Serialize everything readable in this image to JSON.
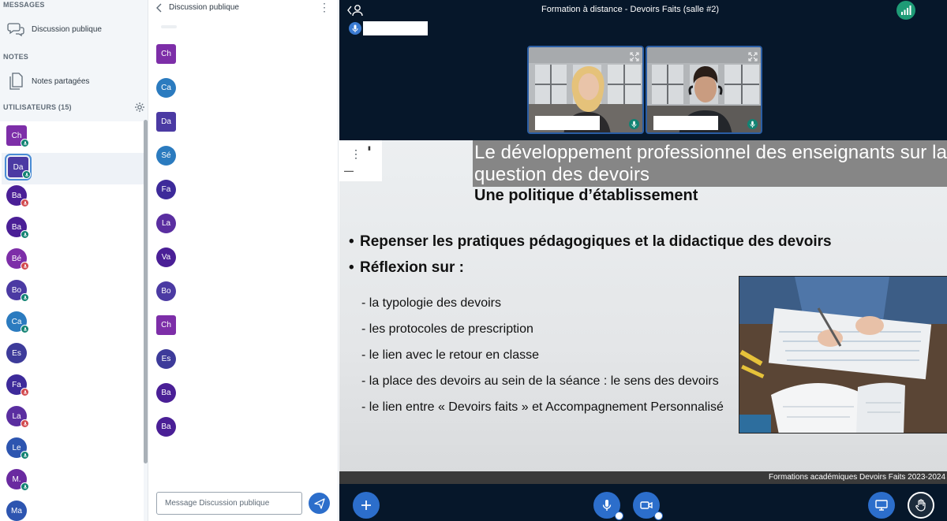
{
  "sidebar": {
    "messages_title": "MESSAGES",
    "public_chat_label": "Discussion publique",
    "notes_title": "NOTES",
    "shared_notes_label": "Notes partagées",
    "users_title": "UTILISATEURS (15)",
    "users": [
      {
        "initials": "Ch",
        "color": "#7d2ea8",
        "shape": "sq",
        "status": "on"
      },
      {
        "initials": "Da",
        "color": "#4b3aa3",
        "shape": "sq",
        "status": "on",
        "presenter": true
      },
      {
        "initials": "Ba",
        "color": "#4a1f96",
        "shape": "rd",
        "status": "off"
      },
      {
        "initials": "Ba",
        "color": "#4a1f96",
        "shape": "rd",
        "status": "on"
      },
      {
        "initials": "Bé",
        "color": "#7d2ea8",
        "shape": "rd",
        "status": "off"
      },
      {
        "initials": "Bo",
        "color": "#4b3aa3",
        "shape": "rd",
        "status": "on"
      },
      {
        "initials": "Ca",
        "color": "#2b7bbf",
        "shape": "rd",
        "status": "on"
      },
      {
        "initials": "Es",
        "color": "#3d3b9a",
        "shape": "rd",
        "status": "none"
      },
      {
        "initials": "Fa",
        "color": "#3d2a9a",
        "shape": "rd",
        "status": "off"
      },
      {
        "initials": "La",
        "color": "#5a2ea0",
        "shape": "rd",
        "status": "off"
      },
      {
        "initials": "Le",
        "color": "#2d55b0",
        "shape": "rd",
        "status": "on"
      },
      {
        "initials": "M.",
        "color": "#6a2aa0",
        "shape": "rd",
        "status": "on"
      },
      {
        "initials": "Ma",
        "color": "#2d55b0",
        "shape": "rd",
        "status": "none"
      }
    ]
  },
  "chat": {
    "title": "Discussion publique",
    "input_placeholder": "Message Discussion publique",
    "messages": [
      {
        "initials": "Ch",
        "color": "#7d2ea8",
        "shape": "sq"
      },
      {
        "initials": "Ca",
        "color": "#2b7bbf",
        "shape": "rd"
      },
      {
        "initials": "Da",
        "color": "#4b3aa3",
        "shape": "sq"
      },
      {
        "initials": "Sé",
        "color": "#2b7bbf",
        "shape": "rd"
      },
      {
        "initials": "Fa",
        "color": "#3d2a9a",
        "shape": "rd"
      },
      {
        "initials": "La",
        "color": "#5a2ea0",
        "shape": "rd"
      },
      {
        "initials": "Va",
        "color": "#4a1f96",
        "shape": "rd"
      },
      {
        "initials": "Bo",
        "color": "#4b3aa3",
        "shape": "rd"
      },
      {
        "initials": "Ch",
        "color": "#7d2ea8",
        "shape": "sq"
      },
      {
        "initials": "Es",
        "color": "#3d3b9a",
        "shape": "rd"
      },
      {
        "initials": "Ba",
        "color": "#4a1f96",
        "shape": "rd"
      },
      {
        "initials": "Ba",
        "color": "#4a1f96",
        "shape": "rd"
      }
    ]
  },
  "meeting": {
    "title": "Formation à distance - Devoirs Faits (salle #2)"
  },
  "slide": {
    "title": "Le développement professionnel des enseignants sur la question des devoirs",
    "subtitle": "Une politique d’établissement",
    "bullets": [
      "Repenser les pratiques pédagogiques et la didactique des devoirs",
      "Réflexion sur :"
    ],
    "subitems": [
      "- la typologie des devoirs",
      "- les protocoles de prescription",
      "- le lien avec le retour en classe",
      "- la place des devoirs au sein de la séance : le sens des devoirs",
      "- le lien entre « Devoirs faits » et Accompagnement Personnalisé"
    ],
    "footer": "Formations académiques Devoirs Faits 2023-2024"
  },
  "colors": {
    "accent": "#2c6ecb",
    "stage_bg": "#06172a",
    "talking": "#128373",
    "muted": "#d24a4f"
  }
}
